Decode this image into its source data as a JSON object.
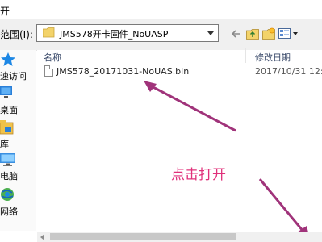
{
  "window": {
    "title": "开"
  },
  "lookin": {
    "label": "范围(I):",
    "folder": "JMS578开卡固件_NoUASP"
  },
  "toolbar": {
    "icons": [
      "back-arrow-icon",
      "up-folder-icon",
      "new-folder-icon",
      "view-menu-icon"
    ]
  },
  "places": [
    {
      "label": "速访问",
      "icon": "star-icon"
    },
    {
      "label": "桌面",
      "icon": "desktop-icon"
    },
    {
      "label": "库",
      "icon": "library-icon"
    },
    {
      "label": "电脑",
      "icon": "computer-icon"
    },
    {
      "label": "网络",
      "icon": "network-icon"
    }
  ],
  "filelist": {
    "columns": {
      "name": "名称",
      "date": "修改日期"
    },
    "files": [
      {
        "name": "JMS578_20171031-NoUAS.bin",
        "date": "2017/10/31 12:3"
      }
    ]
  },
  "annotation": {
    "text": "点击打开",
    "color": "#e0307a"
  },
  "colors": {
    "accent": "#e0307a",
    "star": "#1e88e5"
  }
}
